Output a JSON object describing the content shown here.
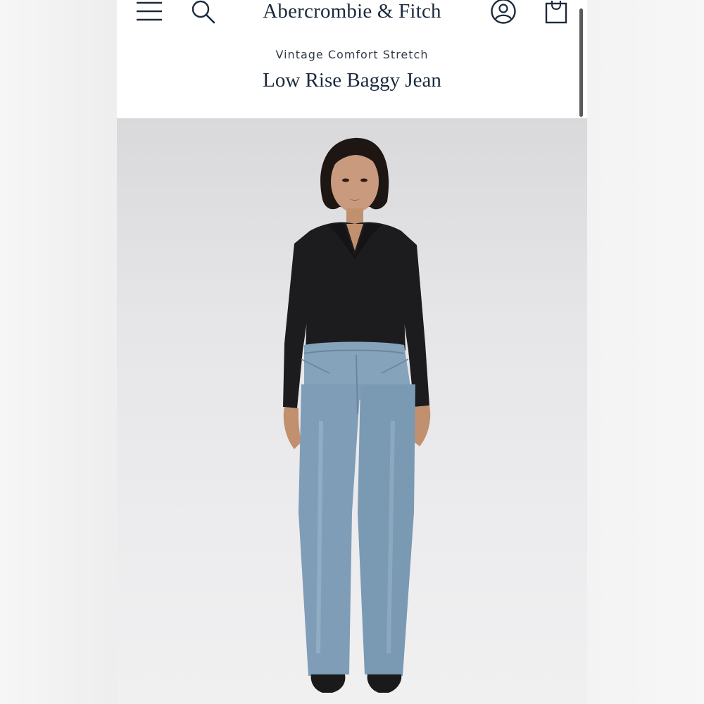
{
  "header": {
    "brand": "Abercrombie & Fitch",
    "menu_icon": "hamburger-menu-icon",
    "search_icon": "search-icon",
    "account_icon": "account-icon",
    "bag_icon": "shopping-bag-icon"
  },
  "product": {
    "collection": "Vintage Comfort Stretch",
    "name": "Low Rise Baggy Jean"
  },
  "colors": {
    "text": "#1b2a3c",
    "denim": "#7f9db7",
    "top": "#1c1c1e"
  }
}
